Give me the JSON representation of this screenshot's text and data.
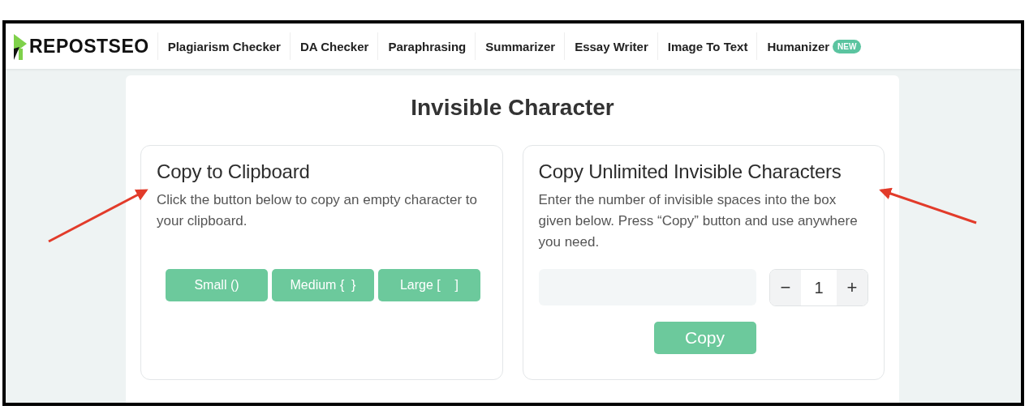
{
  "logo": {
    "text": "REPOSTSEO"
  },
  "nav": [
    {
      "label": "Plagiarism Checker"
    },
    {
      "label": "DA Checker"
    },
    {
      "label": "Paraphrasing"
    },
    {
      "label": "Summarizer"
    },
    {
      "label": "Essay Writer"
    },
    {
      "label": "Image To Text"
    },
    {
      "label": "Humanizer",
      "badge": "NEW"
    }
  ],
  "page_title": "Invisible Character",
  "cards": [
    {
      "kind": "buttons",
      "title": "Copy to Clipboard",
      "text": "Click the button below to copy an empty character to your clipboard.",
      "buttons": [
        "Small ()",
        "Medium {  }",
        "Large [    ]"
      ]
    },
    {
      "kind": "counter",
      "title": "Copy Unlimited Invisible Characters",
      "text": "Enter the number of invisible spaces into the box given below. Press “Copy” button and use anywhere you need.",
      "stepper": {
        "minus": "−",
        "value": "1",
        "plus": "+"
      },
      "button": "Copy"
    }
  ]
}
